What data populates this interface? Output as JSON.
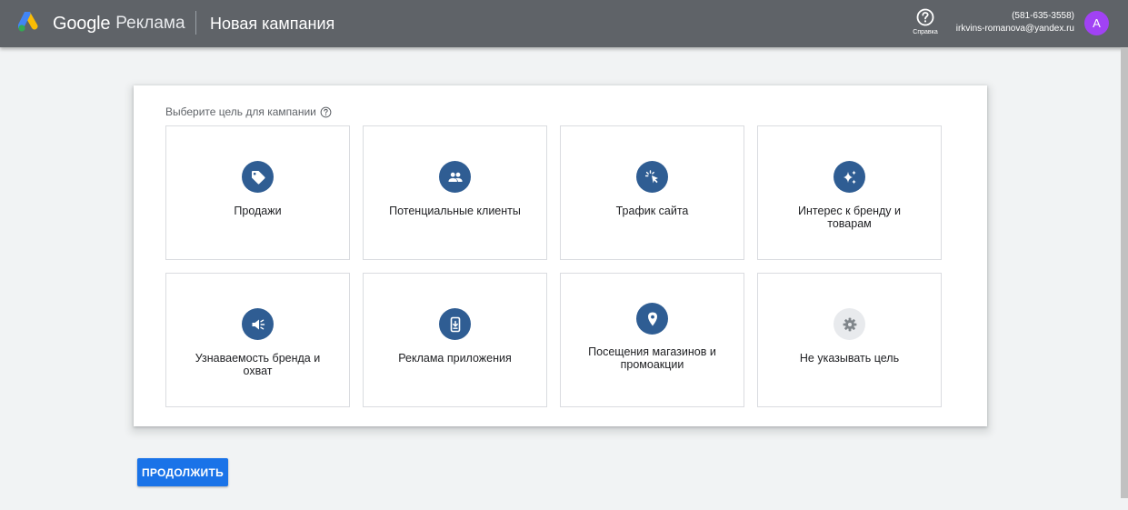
{
  "header": {
    "brand_google": "Google",
    "brand_product": "Реклама",
    "title": "Новая кампания",
    "help_label": "Справка",
    "phone": "(581-635-3558)",
    "email": "irkvins-romanova@yandex.ru",
    "avatar_letter": "A",
    "avatar_color": "#a142f4"
  },
  "main": {
    "prompt": "Выберите цель для кампании",
    "goals": [
      {
        "label": "Продажи",
        "icon": "tag-icon"
      },
      {
        "label": "Потенциальные клиенты",
        "icon": "people-icon"
      },
      {
        "label": "Трафик сайта",
        "icon": "cursor-click-icon"
      },
      {
        "label": "Интерес к бренду и товарам",
        "icon": "sparkle-icon"
      },
      {
        "label": "Узнаваемость бренда и охват",
        "icon": "megaphone-icon"
      },
      {
        "label": "Реклама приложения",
        "icon": "phone-download-icon"
      },
      {
        "label": "Посещения магазинов и промоакции",
        "icon": "location-pin-icon"
      },
      {
        "label": "Не указывать цель",
        "icon": "gear-icon"
      }
    ],
    "continue_label": "ПРОДОЛЖИТЬ"
  },
  "colors": {
    "topbar": "#5f6368",
    "icon_circle": "#2f5d93",
    "primary_button": "#1a73e8"
  }
}
